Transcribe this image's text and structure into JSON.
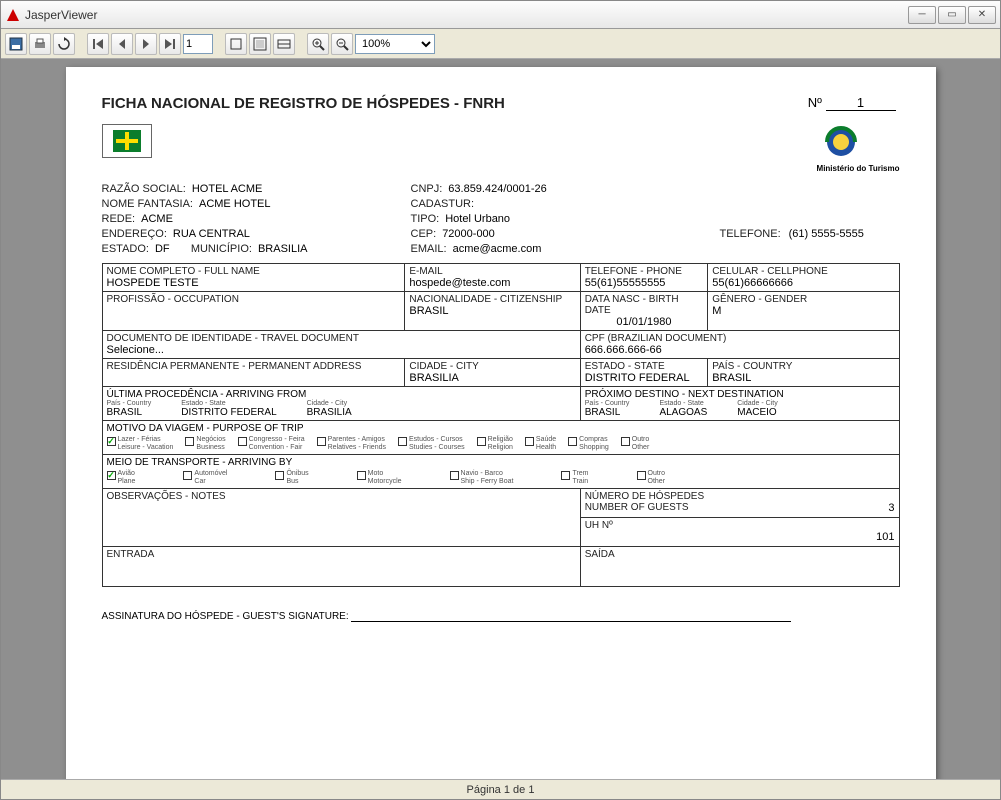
{
  "window": {
    "title": "JasperViewer"
  },
  "toolbar": {
    "page_input": "1",
    "zoom": "100%"
  },
  "statusbar": {
    "text": "Página 1 de 1"
  },
  "doc": {
    "title": "FICHA NACIONAL DE REGISTRO DE HÓSPEDES - FNRH",
    "num_label": "Nº",
    "num_value": "1",
    "ministry": "Ministério do Turismo",
    "razao_label": "RAZÃO SOCIAL:",
    "razao_value": "HOTEL ACME",
    "fantasia_label": "NOME FANTASIA:",
    "fantasia_value": "ACME HOTEL",
    "rede_label": "REDE:",
    "rede_value": "ACME",
    "endereco_label": "ENDEREÇO:",
    "endereco_value": "RUA CENTRAL",
    "estado_label": "ESTADO:",
    "estado_value": "DF",
    "municipio_label": "MUNICÍPIO:",
    "municipio_value": "BRASILIA",
    "cnpj_label": "CNPJ:",
    "cnpj_value": "63.859.424/0001-26",
    "cadastur_label": "CADASTUR:",
    "tipo_label": "TIPO:",
    "tipo_value": "Hotel Urbano",
    "cep_label": "CEP:",
    "cep_value": "72000-000",
    "telefone_label": "TELEFONE:",
    "telefone_value": "(61) 5555-5555",
    "email_label": "EMAIL:",
    "email_value": "acme@acme.com"
  },
  "guest": {
    "name_label": "NOME COMPLETO - FULL NAME",
    "name_value": "HOSPEDE TESTE",
    "email_label": "E-MAIL",
    "email_value": "hospede@teste.com",
    "phone_label": "TELEFONE - PHONE",
    "phone_value": "55(61)55555555",
    "cell_label": "CELULAR - CELLPHONE",
    "cell_value": "55(61)66666666",
    "profession_label": "PROFISSÃO - OCCUPATION",
    "citizenship_label": "NACIONALIDADE - CITIZENSHIP",
    "citizenship_value": "BRASIL",
    "birth_label": "DATA NASC - BIRTH DATE",
    "birth_value": "01/01/1980",
    "gender_label": "GÊNERO - GENDER",
    "gender_value": "M",
    "doc_label": "DOCUMENTO DE IDENTIDADE - TRAVEL DOCUMENT",
    "doc_value": "Selecione...",
    "cpf_label": "CPF (BRAZILIAN DOCUMENT)",
    "cpf_value": "666.666.666-66",
    "addr_label": "RESIDÊNCIA PERMANENTE - PERMANENT ADDRESS",
    "city_label": "CIDADE - CITY",
    "city_value": "BRASILIA",
    "state_label": "ESTADO - STATE",
    "state_value": "DISTRITO FEDERAL",
    "country_label": "PAÍS - COUNTRY",
    "country_value": "BRASIL"
  },
  "arriving": {
    "header": "ÚLTIMA PROCEDÊNCIA - ARRIVING FROM",
    "country_head": "País - Country",
    "country_val": "BRASIL",
    "state_head": "Estado - State",
    "state_val": "DISTRITO FEDERAL",
    "city_head": "Cidade - City",
    "city_val": "BRASILIA"
  },
  "next": {
    "header": "PRÓXIMO DESTINO - NEXT DESTINATION",
    "country_head": "País - Country",
    "country_val": "BRASIL",
    "state_head": "Estado - State",
    "state_val": "ALAGOAS",
    "city_head": "Cidade - City",
    "city_val": "MACEIO"
  },
  "purpose": {
    "header": "MOTIVO DA VIAGEM - PURPOSE OF TRIP",
    "lazer": "Lazer - Férias\nLeisure - Vacation",
    "negocios": "Negócios\nBusiness",
    "congresso": "Congresso - Feira\nConvention - Fair",
    "parentes": "Parentes - Amigos\nRelatives - Friends",
    "estudos": "Estudos - Cursos\nStudies - Courses",
    "religiao": "Religião\nReligion",
    "saude": "Saúde\nHealth",
    "compras": "Compras\nShopping",
    "outro": "Outro\nOther"
  },
  "transport": {
    "header": "MEIO DE TRANSPORTE - ARRIVING BY",
    "aviao": "Avião\nPlane",
    "auto": "Automóvel\nCar",
    "onibus": "Ônibus\nBus",
    "moto": "Moto\nMotorcycle",
    "navio": "Navio - Barco\nShip - Ferry Boat",
    "trem": "Trem\nTrain",
    "outro": "Outro\nOther"
  },
  "footer": {
    "obs_label": "OBSERVAÇÕES - NOTES",
    "guests_label1": "NÚMERO DE HÓSPEDES",
    "guests_label2": "NUMBER OF GUESTS",
    "guests_value": "3",
    "uh_label": "UH Nº",
    "uh_value": "101",
    "entrada_label": "ENTRADA",
    "saida_label": "SAÍDA",
    "sig_label": "ASSINATURA DO HÓSPEDE - GUEST'S SIGNATURE:"
  }
}
